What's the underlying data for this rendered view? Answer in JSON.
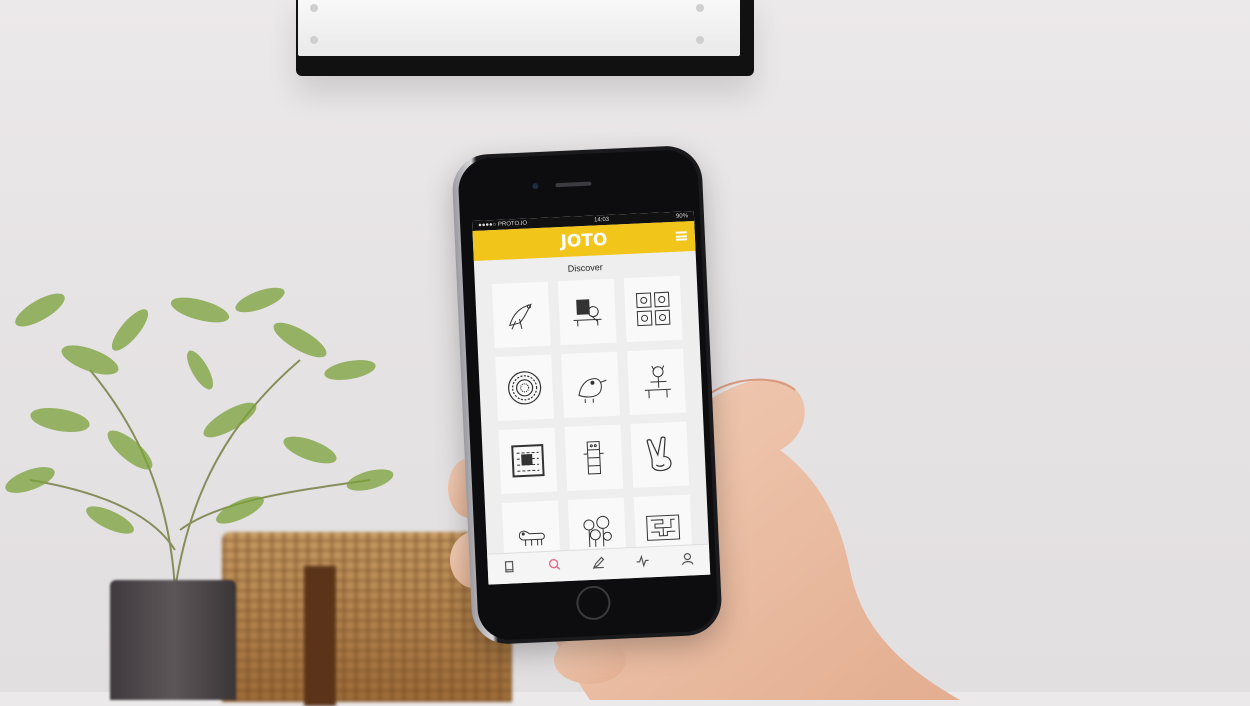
{
  "status_bar": {
    "carrier": "●●●●○ PROTO.IO",
    "time": "14:03",
    "battery": "90%"
  },
  "app": {
    "logo": "JOTO",
    "screen_title": "Discover"
  },
  "artworks": [
    {
      "icon": "bird-drawing-icon"
    },
    {
      "icon": "desk-scene-drawing-icon"
    },
    {
      "icon": "comic-panels-drawing-icon"
    },
    {
      "icon": "mandala-drawing-icon"
    },
    {
      "icon": "bird-figure-drawing-icon"
    },
    {
      "icon": "seated-figure-drawing-icon"
    },
    {
      "icon": "framed-scene-drawing-icon"
    },
    {
      "icon": "totem-drawing-icon"
    },
    {
      "icon": "peace-hand-drawing-icon"
    },
    {
      "icon": "dog-drawing-icon"
    },
    {
      "icon": "flowers-drawing-icon"
    },
    {
      "icon": "maze-drawing-icon"
    }
  ],
  "tabs": [
    {
      "icon": "library-icon",
      "active": false
    },
    {
      "icon": "search-icon",
      "active": true
    },
    {
      "icon": "pen-icon",
      "active": false
    },
    {
      "icon": "activity-icon",
      "active": false
    },
    {
      "icon": "profile-icon",
      "active": false
    }
  ],
  "colors": {
    "accent": "#f2c51a",
    "active_tab": "#e56a8a"
  }
}
